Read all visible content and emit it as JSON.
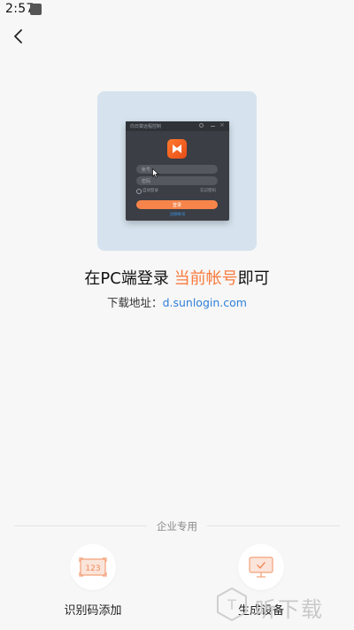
{
  "status_bar": {
    "time": "2:57"
  },
  "illustration": {
    "window_title": "向日葵远程控制",
    "account_placeholder": "帐号",
    "password_placeholder": "密码",
    "auto_login": "自动登录",
    "forgot_password": "忘记密码",
    "login_button": "登录",
    "register_link": "注册帐号"
  },
  "headline": {
    "prefix": "在PC端登录 ",
    "accent": "当前帐号",
    "suffix": "即可"
  },
  "download": {
    "label": "下载地址：",
    "url": "d.sunlogin.com"
  },
  "enterprise": {
    "section_label": "企业专用",
    "actions": [
      {
        "label": "识别码添加",
        "icon": "id-code-icon",
        "icon_text": "123"
      },
      {
        "label": "生成设备",
        "icon": "monitor-check-icon"
      }
    ]
  },
  "watermark": {
    "text": "听下载"
  },
  "colors": {
    "accent": "#f97b3e",
    "link": "#2f7fd8",
    "icon_orange": "#f4a27a",
    "icon_fill": "#fbe4d9"
  }
}
